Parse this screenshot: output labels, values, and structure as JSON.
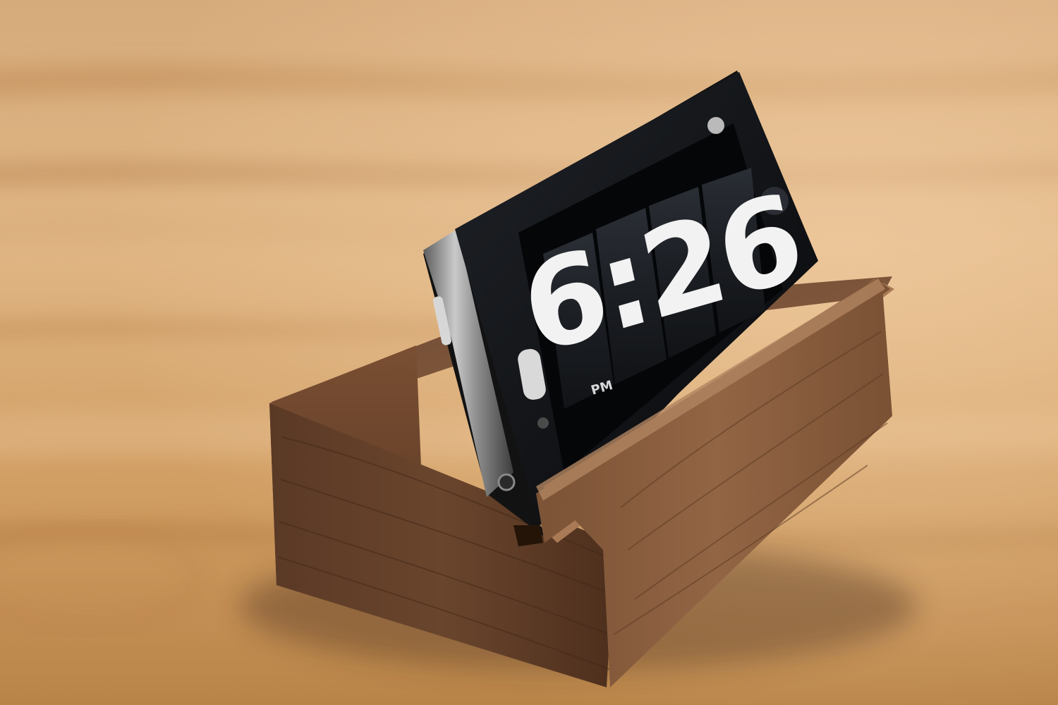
{
  "photo": {
    "subject": "phone-on-wooden-dock",
    "colors": {
      "table_light": "#e3b888",
      "table_mid": "#c8955e",
      "table_dark": "#a9733f",
      "walnut_light": "#8a5d3f",
      "walnut_dark": "#4b2f1f",
      "phone_body": "#151515",
      "steel_band": "#9a9a9a",
      "screen_black": "#050608",
      "flip_card": "#1d2026",
      "digit_color": "#f2f2f2"
    }
  },
  "phone_screen": {
    "time": "6:26",
    "meridiem": "PM"
  }
}
